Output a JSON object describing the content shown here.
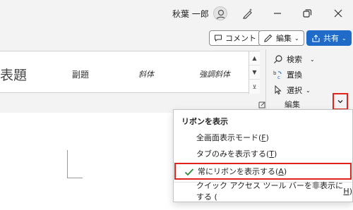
{
  "titlebar": {
    "user_name": "秋葉 一郎",
    "icons": [
      "avatar-icon",
      "pen-sparkle-icon",
      "minimize-icon",
      "restore-icon",
      "close-icon"
    ]
  },
  "actions": {
    "comment_label": "コメント",
    "edit_label": "編集",
    "share_label": "共有"
  },
  "styles_gallery": {
    "items": [
      "表題",
      "副題",
      "斜体",
      "強調斜体"
    ]
  },
  "edit_group": {
    "find_label": "検索",
    "replace_label": "置換",
    "select_label": "選択",
    "group_label": "編集"
  },
  "ribbon_menu": {
    "header": "リボンを表示",
    "items": [
      {
        "text": "全画面表示モード(",
        "key": "F",
        "suffix": ")",
        "checked": false
      },
      {
        "text": "タブのみを表示する(",
        "key": "T",
        "suffix": ")",
        "checked": false
      },
      {
        "text": "常にリボンを表示する(",
        "key": "A",
        "suffix": ")",
        "checked": true
      },
      {
        "text": "クイック アクセス ツール バーを非表示にする (",
        "key": "H",
        "suffix": ")",
        "checked": false
      }
    ]
  },
  "colors": {
    "accent": "#1f6bc7",
    "highlight_red": "#e0231c",
    "check_green": "#2e8b3a"
  }
}
